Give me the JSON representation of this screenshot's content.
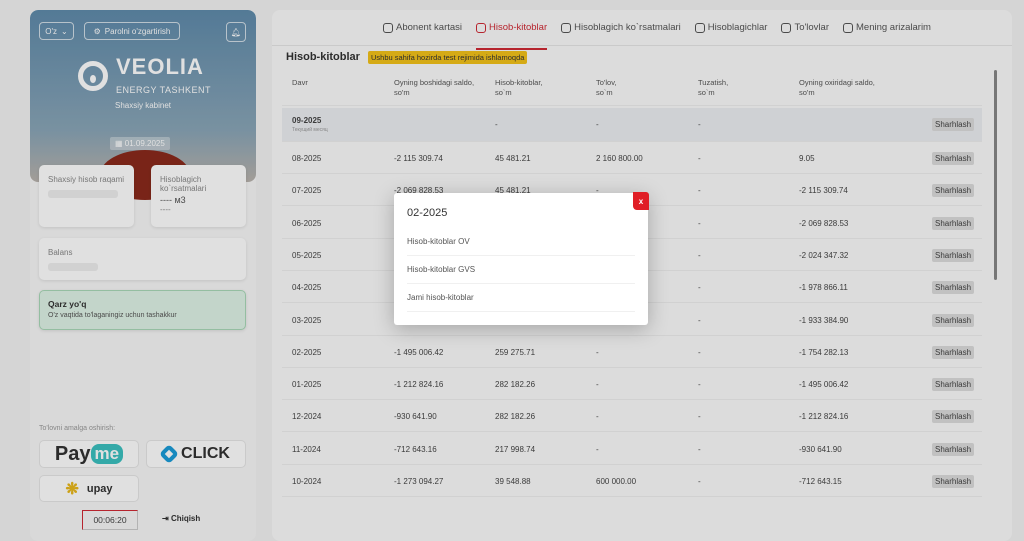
{
  "sidebar": {
    "lang": "O'z",
    "change_password": "Parolni o'zgartirish",
    "brand": "VEOLIA",
    "brand_sub": "ENERGY TASHKENT",
    "cabinet": "Shaxsiy kabinet",
    "date": "01.09.2025",
    "account_label": "Shaxsiy hisob raqami",
    "meter_label": "Hisoblagich ko`rsatmalari",
    "meter_value": "---- м3",
    "meter_sub": "----",
    "balance_label": "Balans",
    "debt_title": "Qarz yo'q",
    "debt_text": "O'z vaqtida to'laganingiz uchun tashakkur",
    "pay_label": "To'lovni amalga oshirish:",
    "payme": "Pay",
    "payme_me": "me",
    "click": "CLICK",
    "upay": "upay",
    "timer": "00:06:20",
    "logout": "Chiqish"
  },
  "tabs": [
    {
      "label": "Abonent kartasi"
    },
    {
      "label": "Hisob-kitoblar",
      "active": true
    },
    {
      "label": "Hisoblagich ko`rsatmalari"
    },
    {
      "label": "Hisoblagichlar"
    },
    {
      "label": "To'lovlar"
    },
    {
      "label": "Mening arizalarim"
    }
  ],
  "page": {
    "title": "Hisob-kitoblar",
    "test_badge": "Ushbu sahifa hozirda test rejimida ishlamoqda"
  },
  "table": {
    "headers": [
      "Davr",
      "Oyning boshidagi saldo,\nso'm",
      "Hisob-kitoblar,\nso`m",
      "To'lov,\nso`m",
      "Tuzatish,\nso`m",
      "Oyning oxiridagi saldo,\nso'm"
    ],
    "action_label": "Sharhlash",
    "current_sub": "Текущий месяц",
    "rows": [
      [
        "09-2025",
        "",
        "-",
        "-",
        "-",
        ""
      ],
      [
        "08-2025",
        "-2 115 309.74",
        "45 481.21",
        "2 160 800.00",
        "-",
        "9.05"
      ],
      [
        "07-2025",
        "-2 069 828.53",
        "45 481.21",
        "-",
        "-",
        "-2 115 309.74"
      ],
      [
        "06-2025",
        "",
        "",
        "",
        "-",
        "-2 069 828.53"
      ],
      [
        "05-2025",
        "",
        "",
        "",
        "-",
        "-2 024 347.32"
      ],
      [
        "04-2025",
        "",
        "",
        "",
        "-",
        "-1 978 866.11"
      ],
      [
        "03-2025",
        "",
        "",
        "",
        "-",
        "-1 933 384.90"
      ],
      [
        "02-2025",
        "-1 495 006.42",
        "259 275.71",
        "-",
        "-",
        "-1 754 282.13"
      ],
      [
        "01-2025",
        "-1 212 824.16",
        "282 182.26",
        "-",
        "-",
        "-1 495 006.42"
      ],
      [
        "12-2024",
        "-930 641.90",
        "282 182.26",
        "-",
        "-",
        "-1 212 824.16"
      ],
      [
        "11-2024",
        "-712 643.16",
        "217 998.74",
        "-",
        "-",
        "-930 641.90"
      ],
      [
        "10-2024",
        "-1 273 094.27",
        "39 548.88",
        "600 000.00",
        "-",
        "-712 643.15"
      ]
    ]
  },
  "modal": {
    "title": "02-2025",
    "items": [
      "Hisob-kitoblar OV",
      "Hisob-kitoblar GVS",
      "Jami hisob-kitoblar"
    ],
    "close": "x"
  },
  "colors": {
    "accent": "#d02a35",
    "badge": "#f3c21a",
    "debt_bg": "#dff3e6"
  }
}
